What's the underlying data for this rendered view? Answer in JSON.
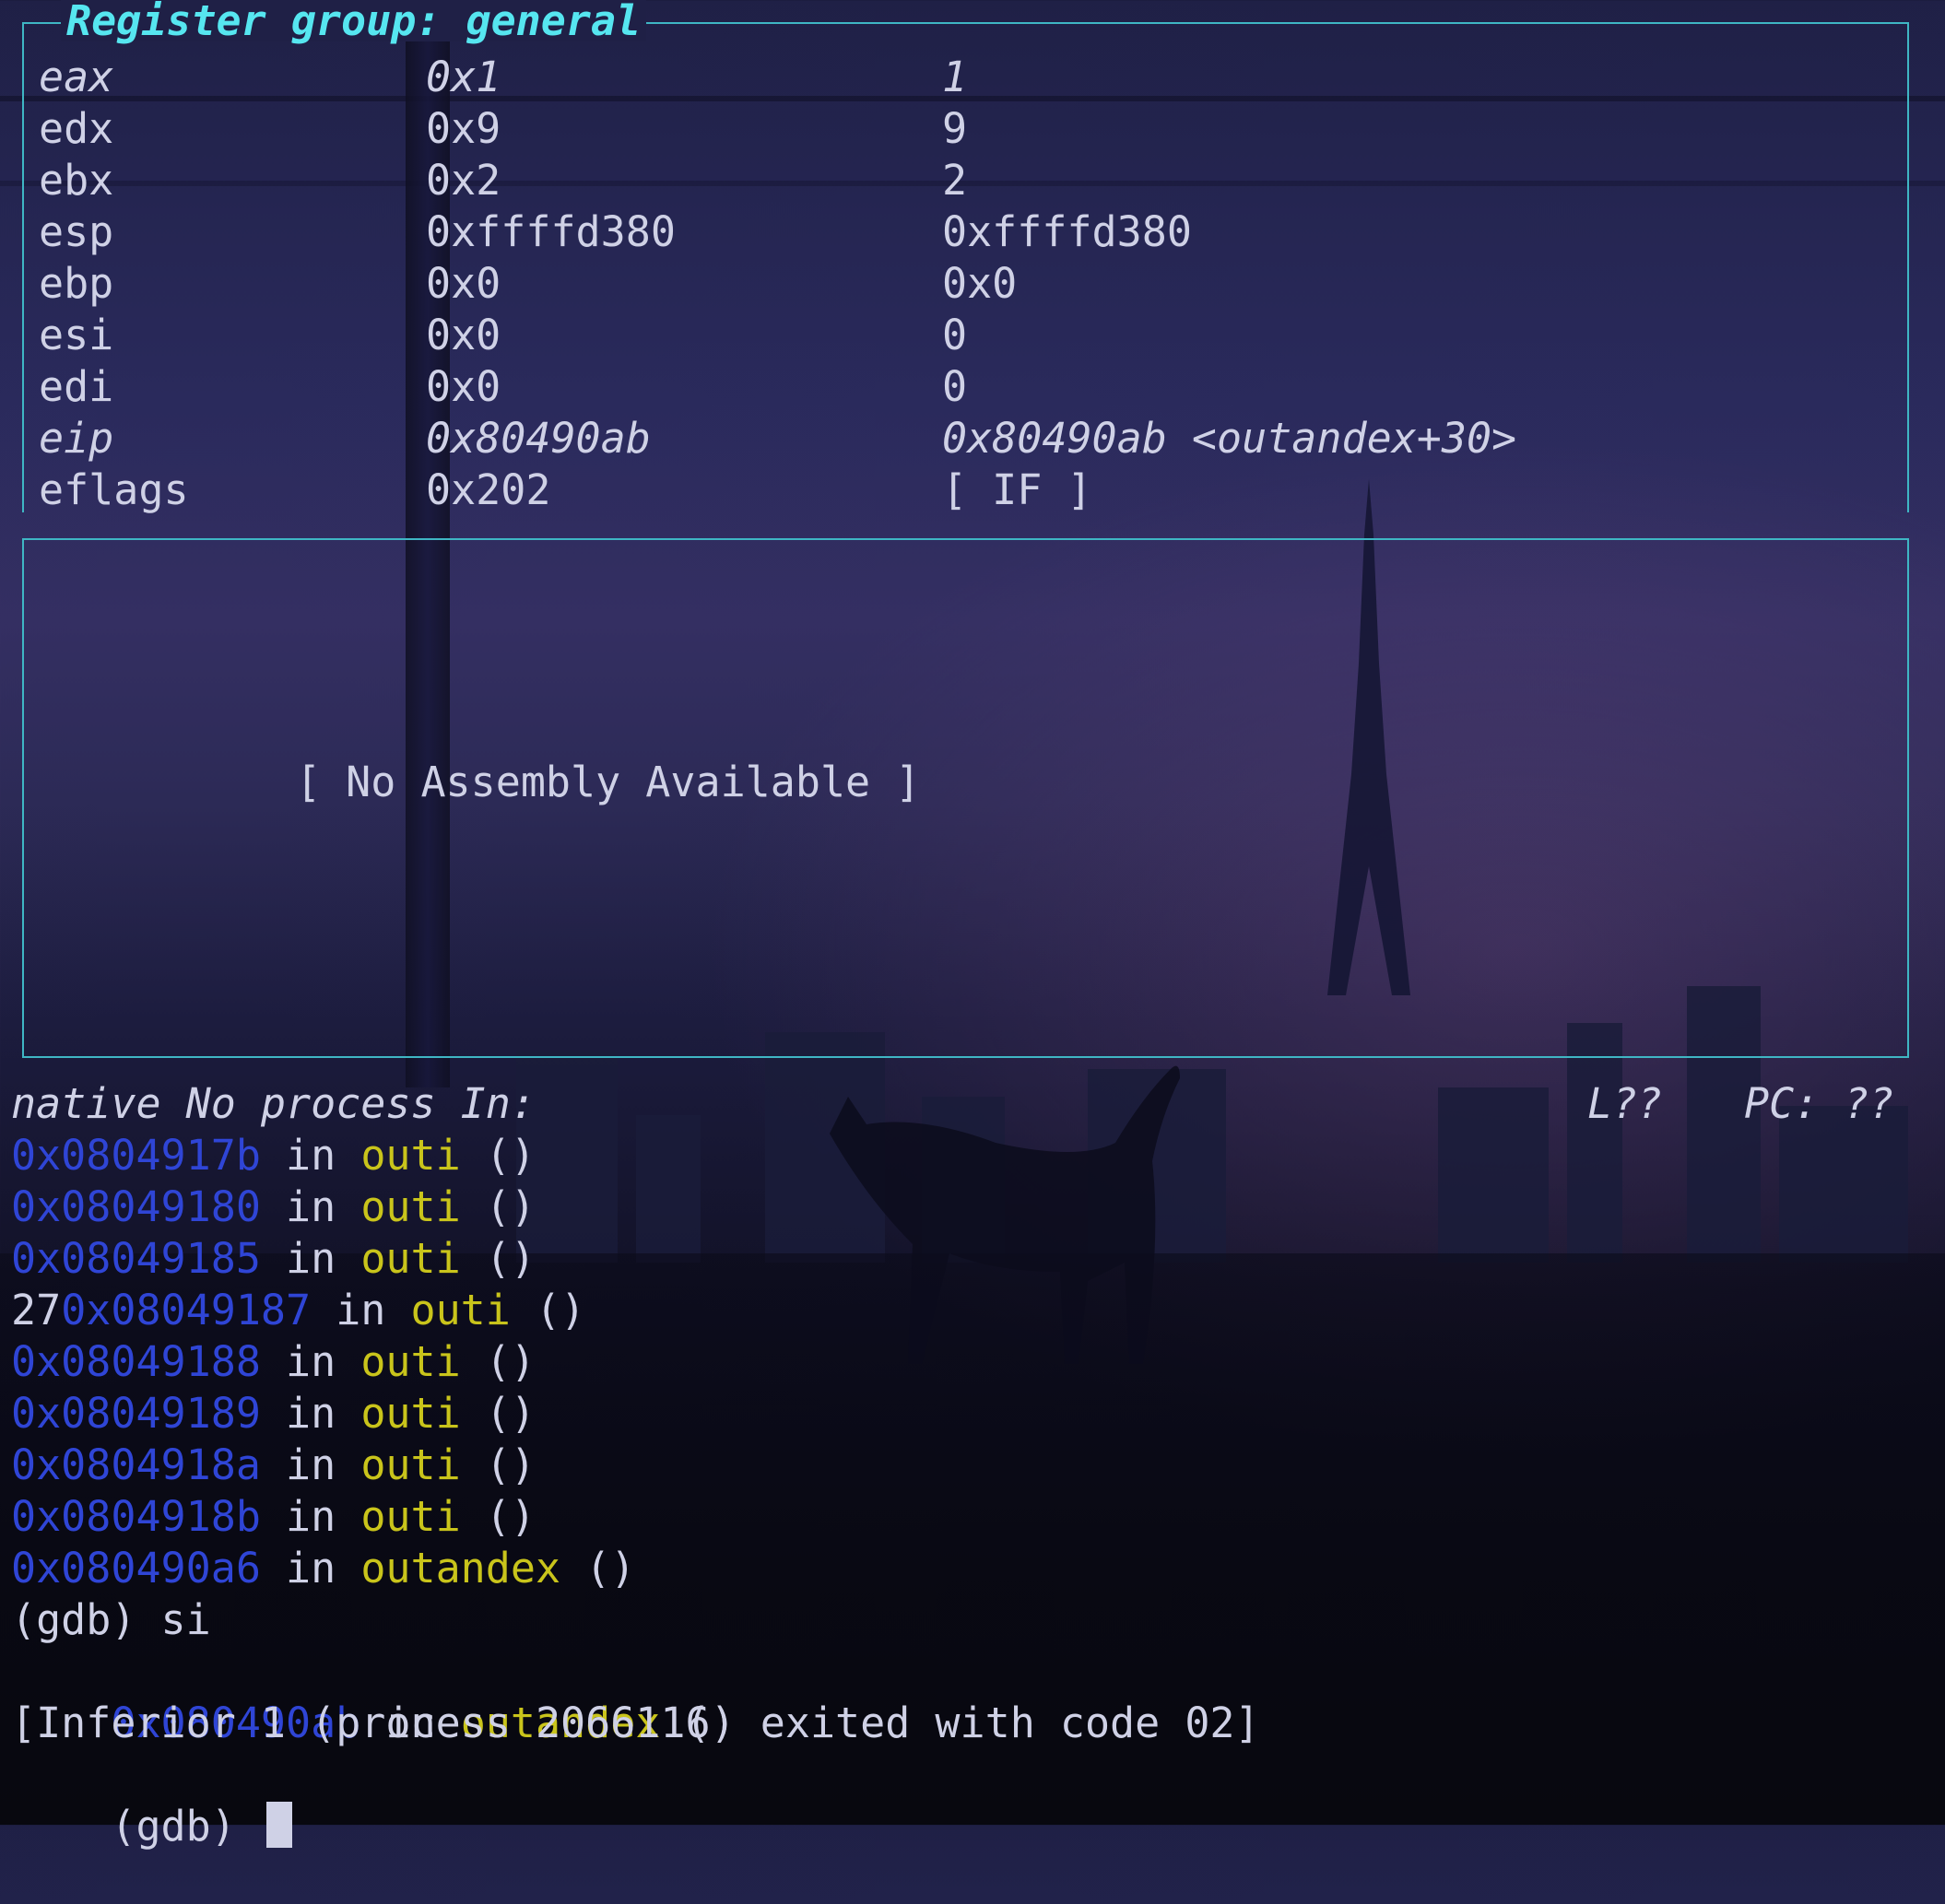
{
  "registers": {
    "title": "Register group: general",
    "rows": [
      {
        "name": "eax",
        "hex": "0x1",
        "value": "1",
        "highlight": true
      },
      {
        "name": "edx",
        "hex": "0x9",
        "value": "9",
        "highlight": false
      },
      {
        "name": "ebx",
        "hex": "0x2",
        "value": "2",
        "highlight": false
      },
      {
        "name": "esp",
        "hex": "0xffffd380",
        "value": "0xffffd380",
        "highlight": false
      },
      {
        "name": "ebp",
        "hex": "0x0",
        "value": "0x0",
        "highlight": false
      },
      {
        "name": "esi",
        "hex": "0x0",
        "value": "0",
        "highlight": false
      },
      {
        "name": "edi",
        "hex": "0x0",
        "value": "0",
        "highlight": false
      },
      {
        "name": "eip",
        "hex": "0x80490ab",
        "value": "0x80490ab <outandex+30>",
        "highlight": true
      },
      {
        "name": "eflags",
        "hex": "0x202",
        "value": "[ IF ]",
        "highlight": false
      }
    ]
  },
  "assembly": {
    "empty_text": "[ No Assembly Available ]"
  },
  "status_bar": {
    "left": "native No process In:",
    "line": "L??",
    "pc": "PC: ??"
  },
  "console": {
    "frames": [
      {
        "prefix": "",
        "addr": "0x0804917b",
        "in": " in ",
        "fn": "outi",
        "tail": " ()"
      },
      {
        "prefix": "",
        "addr": "0x08049180",
        "in": " in ",
        "fn": "outi",
        "tail": " ()"
      },
      {
        "prefix": "",
        "addr": "0x08049185",
        "in": " in ",
        "fn": "outi",
        "tail": " ()"
      },
      {
        "prefix": "27",
        "addr": "0x08049187",
        "in": " in ",
        "fn": "outi",
        "tail": " ()"
      },
      {
        "prefix": "",
        "addr": "0x08049188",
        "in": " in ",
        "fn": "outi",
        "tail": " ()"
      },
      {
        "prefix": "",
        "addr": "0x08049189",
        "in": " in ",
        "fn": "outi",
        "tail": " ()"
      },
      {
        "prefix": "",
        "addr": "0x0804918a",
        "in": " in ",
        "fn": "outi",
        "tail": " ()"
      },
      {
        "prefix": "",
        "addr": "0x0804918b",
        "in": " in ",
        "fn": "outi",
        "tail": " ()"
      },
      {
        "prefix": "",
        "addr": "0x080490a6",
        "in": " in ",
        "fn": "outandex",
        "tail": " ()"
      }
    ],
    "command": "(gdb) si",
    "last_frame": {
      "addr": "0x080490ab",
      "in": " in ",
      "fn": "outandex",
      "tail": " ()"
    },
    "exit_message": "[Inferior 1 (process 2066116) exited with code 02]",
    "prompt": "(gdb) "
  },
  "colors": {
    "border": "#3fb6c4",
    "title": "#56e6f0",
    "address": "#2f45d6",
    "function": "#c9c41b",
    "text": "#cfd1e6"
  }
}
